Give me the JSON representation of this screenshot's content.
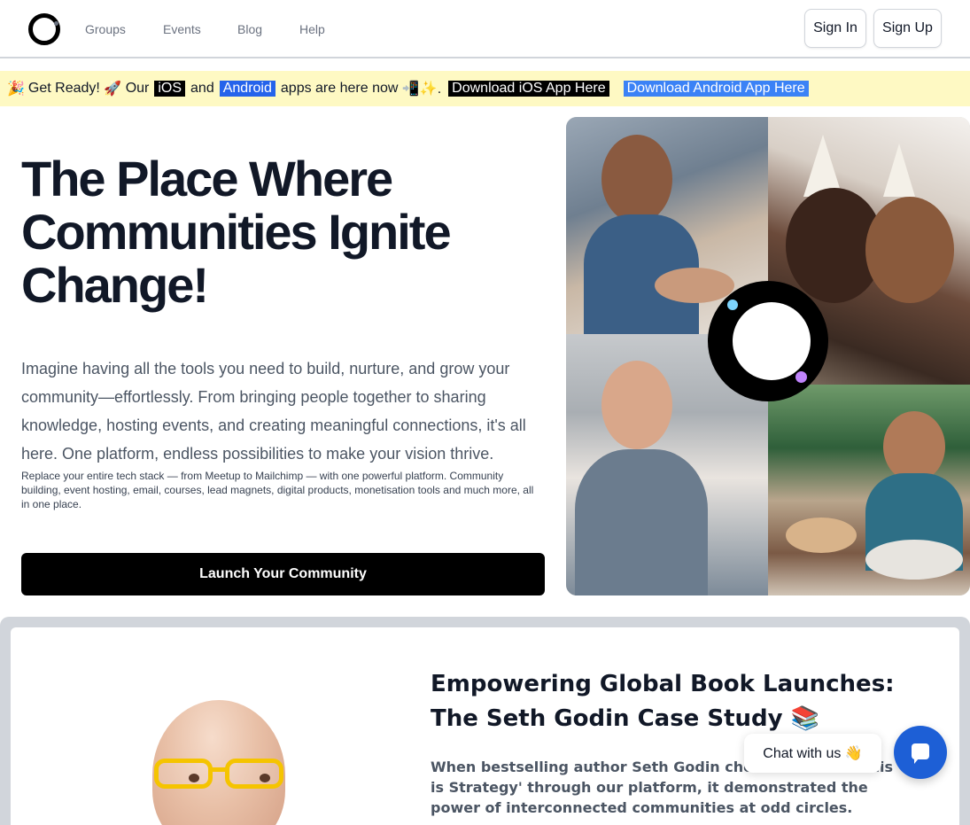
{
  "nav": {
    "links": [
      "Groups",
      "Events",
      "Blog",
      "Help"
    ],
    "sign_in": "Sign In",
    "sign_up": "Sign Up"
  },
  "banner": {
    "lead_emoji": "🎉",
    "text_1": "Get Ready!",
    "rocket": "🚀",
    "text_2": "Our",
    "ios": "iOS",
    "and": "and",
    "android": "Android",
    "text_3": "apps are here now",
    "trail_emoji": "📲✨.",
    "download_ios": "Download iOS App Here",
    "download_android": "Download Android App Here"
  },
  "hero": {
    "title": "The Place Where Communities Ignite Change!",
    "description": "Imagine having all the tools you need to build, nurture, and grow your community—effortlessly. From bringing people together to sharing knowledge, hosting events, and creating meaningful connections, it's all here. One platform, endless possibilities to make your vision thrive.",
    "subtext": "Replace your entire tech stack — from Meetup to Mailchimp — with one powerful platform. Community building, event hosting, email, courses, lead magnets, digital products, monetisation tools and much more, all in one place.",
    "cta": "Launch Your Community"
  },
  "case_study": {
    "title": "Empowering Global Book Launches: The Seth Godin Case Study 📚",
    "text": "When bestselling author Seth Godin chose to launch 'This is Strategy' through our platform, it demonstrated the power of interconnected communities at odd circles."
  },
  "chat": {
    "label": "Chat with us 👋"
  },
  "colors": {
    "banner_bg": "#fef9c3",
    "ios_tag": "#000000",
    "android_tag": "#2563eb",
    "chat_button": "#1d5fd6",
    "logo_dot_blue": "#7dd3fc",
    "logo_dot_purple": "#c084fc"
  }
}
